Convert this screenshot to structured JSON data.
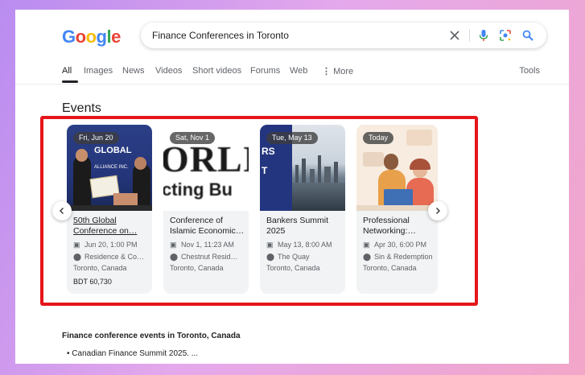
{
  "logo": {
    "letters": [
      "G",
      "o",
      "o",
      "g",
      "l",
      "e"
    ],
    "colors": [
      "#4285F4",
      "#EA4335",
      "#FBBC05",
      "#4285F4",
      "#34A853",
      "#EA4335"
    ]
  },
  "search": {
    "query": "Finance Conferences in Toronto",
    "clear_icon": "close-icon",
    "mic_icon": "mic-icon",
    "lens_icon": "lens-icon",
    "search_icon": "search-icon"
  },
  "tabs": [
    "All",
    "Images",
    "News",
    "Videos",
    "Short videos",
    "Forums",
    "Web",
    "More"
  ],
  "tools_label": "Tools",
  "events_title": "Events",
  "events": [
    {
      "date": "Fri, Jun 20",
      "title": "50th Global Conference on…",
      "when": "Jun 20, 1:00 PM",
      "venue": "Residence & Co…",
      "location": "Toronto, Canada",
      "price": "BDT 60,730"
    },
    {
      "date": "Sat, Nov 1",
      "title": "Conference of Islamic Economic…",
      "when": "Nov 1, 11:23 AM",
      "venue": "Chestnut Resid…",
      "location": "Toronto, Canada",
      "price": ""
    },
    {
      "date": "Tue, May 13",
      "title": "Bankers Summit 2025",
      "when": "May 13, 8:00 AM",
      "venue": "The Quay",
      "location": "Toronto, Canada",
      "price": ""
    },
    {
      "date": "Today",
      "title": "Professional Networking:…",
      "when": "Apr 30, 6:00 PM",
      "venue": "Sin & Redemption",
      "location": "Toronto, Canada",
      "price": ""
    }
  ],
  "card1_banner": [
    "GLOBAL",
    "ALLIANCE INC."
  ],
  "card2_banner": [
    "ORLI",
    "cting Bu"
  ],
  "card3_banner": [
    "RS",
    "T"
  ],
  "accent_red": "#e5161b",
  "results": {
    "heading": "Finance conference events in Toronto, Canada",
    "bullets": [
      "Canadian Finance Summit 2025. ..."
    ]
  }
}
